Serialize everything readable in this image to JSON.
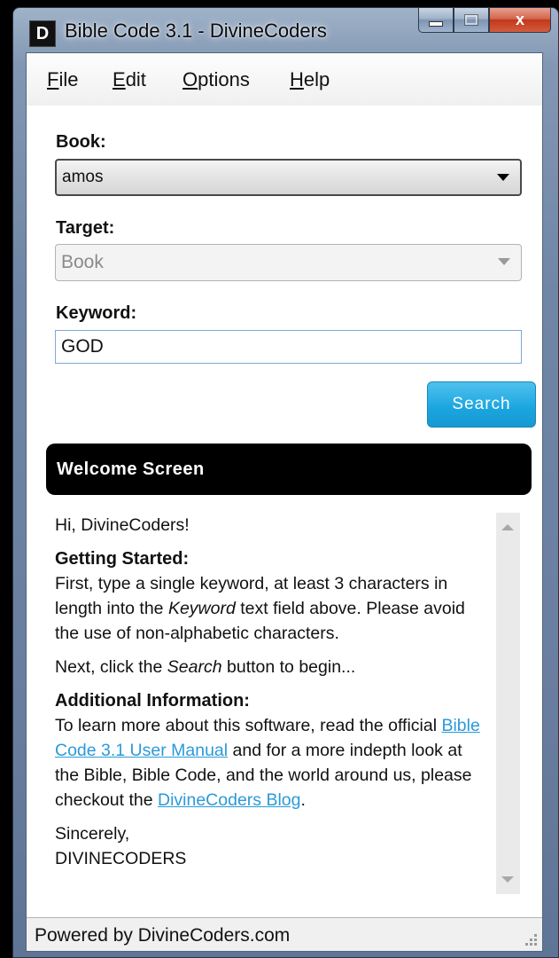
{
  "window": {
    "logo_letter": "D",
    "title": "Bible Code 3.1 - DivineCoders",
    "close_glyph": "x"
  },
  "menu": [
    {
      "accel": "F",
      "rest": "ile"
    },
    {
      "accel": "E",
      "rest": "dit"
    },
    {
      "accel": "O",
      "rest": "ptions"
    },
    {
      "accel": "H",
      "rest": "elp"
    }
  ],
  "form": {
    "book_label": "Book:",
    "book_value": "amos",
    "target_label": "Target:",
    "target_value": "Book",
    "keyword_label": "Keyword:",
    "keyword_value": "GOD",
    "search_label": "Search"
  },
  "panel": {
    "header": "Welcome Screen",
    "greeting": "Hi, DivineCoders!",
    "getting_started_heading": "Getting Started:",
    "gs_text_1": "First, type a single keyword, at least 3 characters in length into the ",
    "gs_em": "Keyword",
    "gs_text_2": " text field above. Please avoid the use of non-alphabetic characters.",
    "next_text_1": "Next, click the ",
    "next_em": "Search",
    "next_text_2": " button to begin...",
    "additional_heading": "Additional Information:",
    "ai_text_1": "To learn more about this software, read the official ",
    "ai_link_1": "Bible Code 3.1 User Manual",
    "ai_text_2": " and for a more indepth look at the Bible, Bible Code, and the world around us, please checkout the ",
    "ai_link_2": "DivineCoders Blog",
    "ai_text_3": ".",
    "signoff": "Sincerely,",
    "signature": "DIVINECODERS"
  },
  "status": {
    "text": "Powered by DivineCoders.com"
  },
  "colors": {
    "search_button": "#1aa5df",
    "link": "#2b9ad8",
    "header_bg": "#000000"
  }
}
